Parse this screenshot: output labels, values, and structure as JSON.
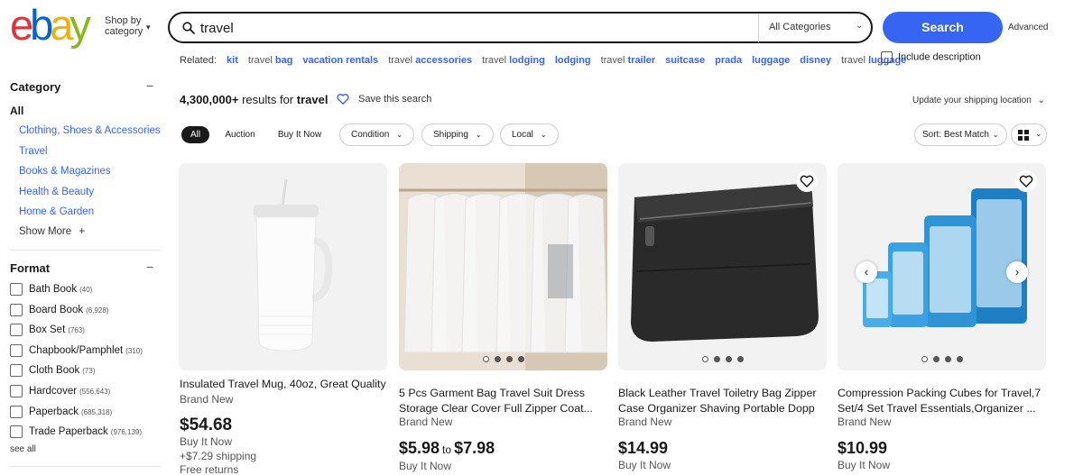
{
  "header": {
    "logo_letters": [
      {
        "ch": "e",
        "color": "#e53238"
      },
      {
        "ch": "b",
        "color": "#0064d2"
      },
      {
        "ch": "a",
        "color": "#f5af02"
      },
      {
        "ch": "y",
        "color": "#86b817"
      }
    ],
    "shop_by_line1": "Shop by",
    "shop_by_line2": "category",
    "search_value": "travel",
    "category_select": "All Categories",
    "search_button": "Search",
    "advanced": "Advanced",
    "include_description": "Include description"
  },
  "related": {
    "label": "Related:",
    "links": [
      {
        "plain": "",
        "bold": "kit"
      },
      {
        "plain": "travel ",
        "bold": "bag"
      },
      {
        "plain": "",
        "bold": "vacation rentals"
      },
      {
        "plain": "travel ",
        "bold": "accessories"
      },
      {
        "plain": "travel ",
        "bold": "lodging"
      },
      {
        "plain": "",
        "bold": "lodging"
      },
      {
        "plain": "travel ",
        "bold": "trailer"
      },
      {
        "plain": "",
        "bold": "suitcase"
      },
      {
        "plain": "",
        "bold": "prada"
      },
      {
        "plain": "",
        "bold": "luggage"
      },
      {
        "plain": "",
        "bold": "disney"
      },
      {
        "plain": "travel ",
        "bold": "luggage"
      }
    ]
  },
  "sidebar": {
    "category_heading": "Category",
    "all_label": "All",
    "categories": [
      "Clothing, Shoes & Accessories",
      "Travel",
      "Books & Magazines",
      "Health & Beauty",
      "Home & Garden"
    ],
    "show_more": "Show More",
    "format_heading": "Format",
    "formats": [
      {
        "label": "Bath Book",
        "count": "(40)"
      },
      {
        "label": "Board Book",
        "count": "(6,928)"
      },
      {
        "label": "Box Set",
        "count": "(763)"
      },
      {
        "label": "Chapbook/Pamphlet",
        "count": "(310)"
      },
      {
        "label": "Cloth Book",
        "count": "(73)"
      },
      {
        "label": "Hardcover",
        "count": "(556,643)"
      },
      {
        "label": "Paperback",
        "count": "(685,318)"
      },
      {
        "label": "Trade Paperback",
        "count": "(976,139)"
      }
    ],
    "see_all": "see all"
  },
  "results": {
    "count": "4,300,000+",
    "results_for": "results for",
    "query": "travel",
    "save_search": "Save this search",
    "shipping_location": "Update your shipping location",
    "tabs": [
      "All",
      "Auction",
      "Buy It Now"
    ],
    "filters": [
      "Condition",
      "Shipping",
      "Local"
    ],
    "sort": "Sort: Best Match"
  },
  "products": [
    {
      "title": "Insulated Travel Mug, 40oz, Great Quality",
      "condition": "Brand New",
      "price": "$54.68",
      "price_to": "",
      "buy_format": "Buy It Now",
      "shipping": "+$7.29 shipping",
      "returns": "Free returns",
      "dots": 0
    },
    {
      "title": "5 Pcs Garment Bag Travel Suit Dress Storage Clear Cover Full Zipper Coat...",
      "condition": "Brand New",
      "price": "$5.98",
      "price_to": "to",
      "price_high": "$7.98",
      "buy_format": "Buy It Now",
      "dots": 4
    },
    {
      "title": "Black Leather Travel Toiletry Bag Zipper Case Organizer Shaving Portable Dopp",
      "condition": "Brand New",
      "price": "$14.99",
      "buy_format": "Buy It Now",
      "dots": 4
    },
    {
      "title": "Compression Packing Cubes for Travel,7 Set/4 Set Travel Essentials,Organizer ...",
      "condition": "Brand New",
      "price": "$10.99",
      "buy_format": "Buy It Now",
      "dots": 4
    }
  ]
}
